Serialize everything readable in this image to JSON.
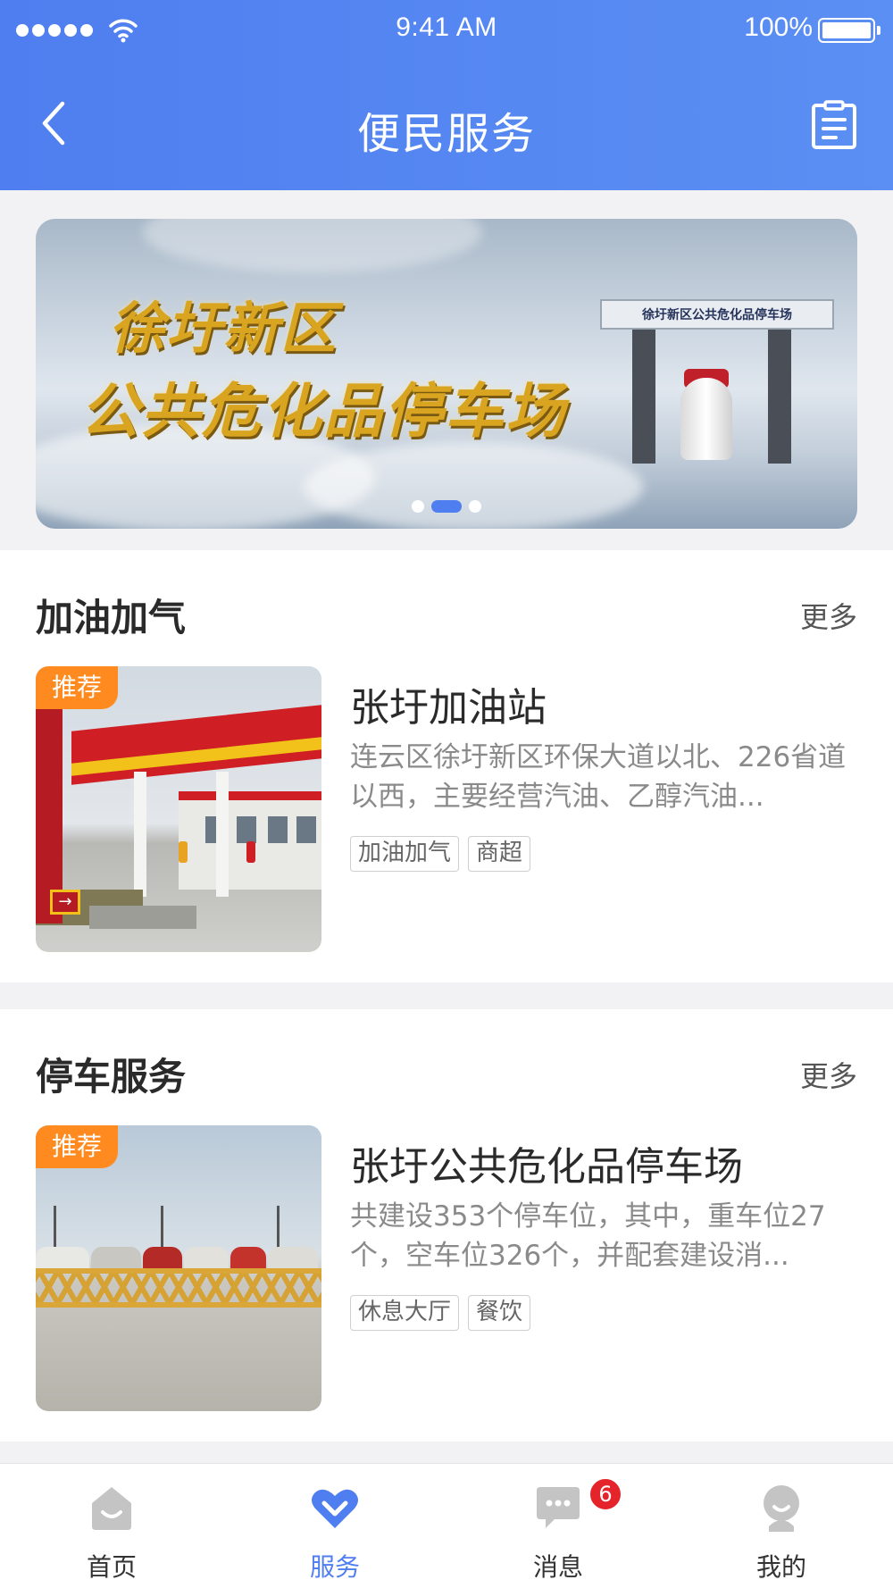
{
  "status_bar": {
    "time": "9:41 AM",
    "battery": "100%",
    "icons": [
      "signal-dots-icon",
      "wifi-icon",
      "battery-icon"
    ]
  },
  "nav": {
    "title": "便民服务",
    "back_icon": "chevron-left-icon",
    "right_icon": "document-list-icon"
  },
  "banner": {
    "title_line_1": "徐圩新区",
    "title_line_2": "公共危化品停车场",
    "gate_sign": "徐圩新区公共危化品停车场",
    "page_count": 3,
    "active_index": 1
  },
  "sections": [
    {
      "title": "加油加气",
      "more": "更多",
      "card": {
        "badge": "推荐",
        "title": "张圩加油站",
        "desc": "连云区徐圩新区环保大道以北、226省道以西，主要经营汽油、乙醇汽油...",
        "tags": [
          "加油加气",
          "商超"
        ]
      }
    },
    {
      "title": "停车服务",
      "more": "更多",
      "card": {
        "badge": "推荐",
        "title": "张圩公共危化品停车场",
        "desc": "共建设353个停车位，其中，重车位27个，空车位326个，并配套建设消...",
        "tags": [
          "休息大厅",
          "餐饮"
        ]
      }
    }
  ],
  "tabbar": {
    "items": [
      {
        "label": "首页",
        "icon": "home-icon",
        "active": false
      },
      {
        "label": "服务",
        "icon": "service-heart-icon",
        "active": true
      },
      {
        "label": "消息",
        "icon": "message-icon",
        "active": false,
        "badge": "6"
      },
      {
        "label": "我的",
        "icon": "profile-icon",
        "active": false
      }
    ]
  },
  "colors": {
    "primary": "#4f7ef0",
    "badge": "#ff8a1f",
    "notification": "#e5232a"
  }
}
